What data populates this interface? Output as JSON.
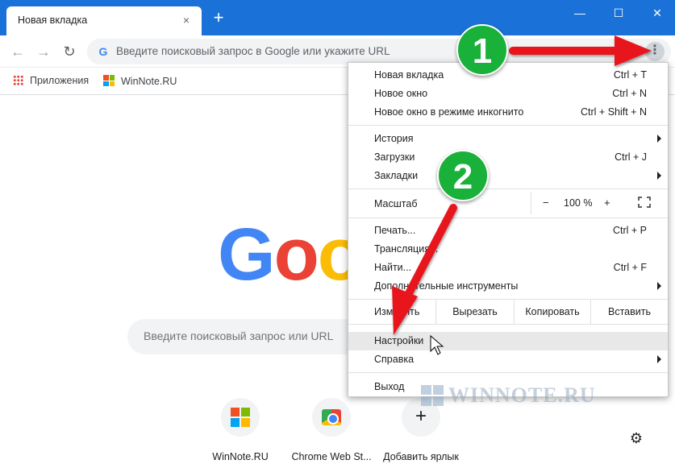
{
  "window": {
    "tab_title": "Новая вкладка",
    "tab_close": "×",
    "new_tab": "+",
    "minimize": "—",
    "maximize": "☐",
    "close": "✕"
  },
  "toolbar": {
    "back": "←",
    "forward": "→",
    "reload": "↻",
    "omnibox_g": "G",
    "omnibox_placeholder": "Введите поисковый запрос в Google или укажите URL",
    "menu_dots": "⋮"
  },
  "bookmarks": {
    "items": [
      {
        "label": "Приложения",
        "icon": "apps-grid-icon"
      },
      {
        "label": "WinNote.RU",
        "icon": "windows-logo-icon"
      }
    ]
  },
  "page": {
    "logo_letters": [
      "G",
      "o",
      "o"
    ],
    "search_placeholder": "Введите поисковый запрос или URL",
    "shortcuts": [
      {
        "label": "WinNote.RU",
        "icon": "windows-logo-icon"
      },
      {
        "label": "Chrome Web St...",
        "icon": "chrome-web-store-icon"
      },
      {
        "label": "Добавить ярлык",
        "icon": "plus-icon"
      }
    ],
    "settings_gear": "⚙"
  },
  "menu": {
    "new_tab": {
      "label": "Новая вкладка",
      "shortcut": "Ctrl + T"
    },
    "new_window": {
      "label": "Новое окно",
      "shortcut": "Ctrl + N"
    },
    "incognito": {
      "label": "Новое окно в режиме инкогнито",
      "shortcut": "Ctrl + Shift + N"
    },
    "history": {
      "label": "История"
    },
    "downloads": {
      "label": "Загрузки",
      "shortcut": "Ctrl + J"
    },
    "bookmarks": {
      "label": "Закладки"
    },
    "zoom": {
      "label": "Масштаб",
      "minus": "−",
      "value": "100 %",
      "plus": "+"
    },
    "print": {
      "label": "Печать...",
      "shortcut": "Ctrl + P"
    },
    "cast": {
      "label": "Трансляция..."
    },
    "find": {
      "label": "Найти...",
      "shortcut": "Ctrl + F"
    },
    "more_tools": {
      "label": "Дополнительные инструменты"
    },
    "edit": {
      "label": "Изменить",
      "cut": "Вырезать",
      "copy": "Копировать",
      "paste": "Вставить"
    },
    "settings": {
      "label": "Настройки"
    },
    "help": {
      "label": "Справка"
    },
    "exit": {
      "label": "Выход"
    }
  },
  "annotations": {
    "badge1": "1",
    "badge2": "2",
    "arrow_color": "#e8141b",
    "badge_color": "#19b13a"
  },
  "watermark": "WINNOTE.RU",
  "colors": {
    "titlebar": "#1a72d8",
    "google_blue": "#4285f4",
    "google_red": "#ea4335",
    "google_yellow": "#fbbc05"
  }
}
